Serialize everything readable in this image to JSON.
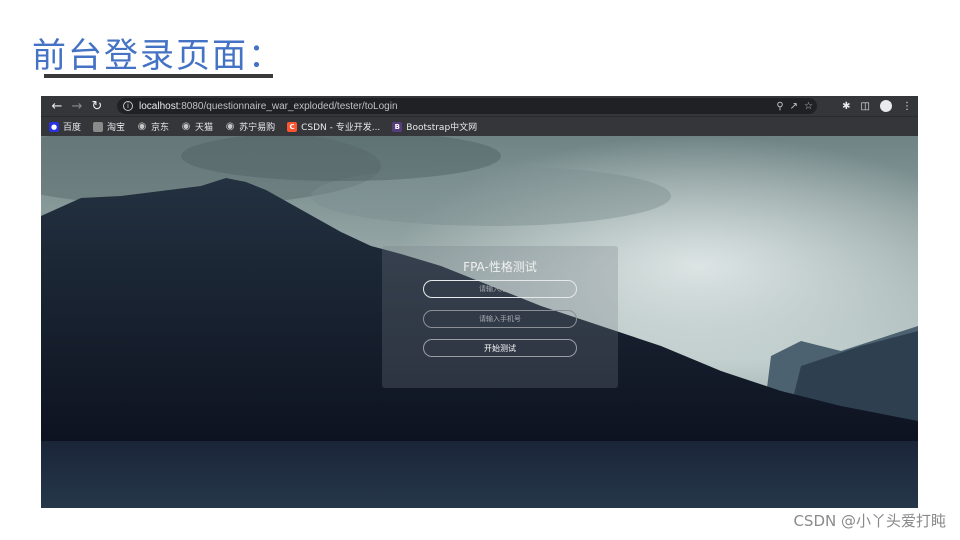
{
  "slide": {
    "title": "前台登录页面：",
    "watermark": "CSDN @小丫头爱打盹"
  },
  "browser": {
    "url_host": "localhost",
    "url_rest": ":8080/questionnaire_war_exploded/tester/toLogin",
    "bookmarks": [
      {
        "label": "百度",
        "icon": "baidu-icon",
        "color": "#2932e1"
      },
      {
        "label": "淘宝",
        "icon": "taobao-icon",
        "color": "#8a8a8a"
      },
      {
        "label": "京东",
        "icon": "globe-icon",
        "color": "#5f6368"
      },
      {
        "label": "天猫",
        "icon": "globe-icon",
        "color": "#5f6368"
      },
      {
        "label": "苏宁易购",
        "icon": "globe-icon",
        "color": "#5f6368"
      },
      {
        "label": "CSDN - 专业开发...",
        "icon": "csdn-icon",
        "color": "#fc5531"
      },
      {
        "label": "Bootstrap中文网",
        "icon": "bootstrap-icon",
        "color": "#563d7c"
      }
    ]
  },
  "login": {
    "title": "FPA-性格测试",
    "username_placeholder": "请输入用户名",
    "phone_placeholder": "请输入手机号",
    "start_label": "开始测试"
  },
  "colors": {
    "accent_title": "#4472c4",
    "toolbar": "#35363a"
  }
}
